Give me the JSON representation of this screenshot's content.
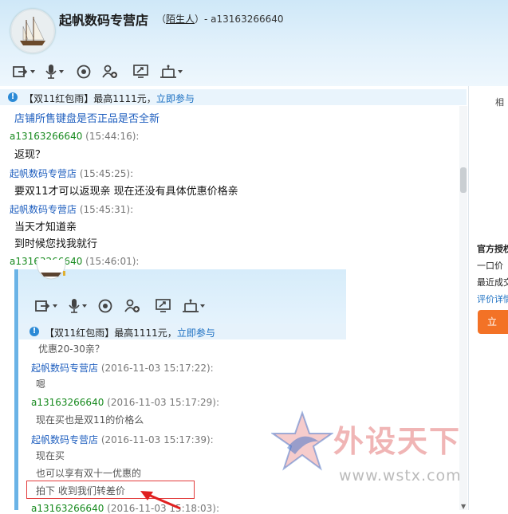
{
  "header": {
    "shop_name": "起帆数码专营店",
    "relation_prefix": "（",
    "relation": "陌生人",
    "relation_suffix": "）- a13163266640"
  },
  "toolbar": [
    "share-screen-icon",
    "microphone-icon",
    "camera-icon",
    "add-contact-icon",
    "screenshot-icon",
    "robot-icon"
  ],
  "notice": {
    "text": "【双11红包雨】最高1111元，",
    "link": "立即参与"
  },
  "messages": [
    {
      "text": "店铺所售键盘是否正品是否全新"
    },
    {
      "name": "a13163266640",
      "time": "(15:44:16):",
      "text": "返现？"
    },
    {
      "name": "起帆数码专营店",
      "time": "(15:45:25):",
      "text": "要双11才可以返现亲 现在还没有具体优惠价格亲"
    },
    {
      "name": "起帆数码专营店",
      "time": "(15:45:31):",
      "lines": [
        "当天才知道亲",
        "到时候您找我就行"
      ]
    },
    {
      "name": "a13163266640",
      "time": "(15:46:01):"
    }
  ],
  "embedded": {
    "notice_text": "【双11红包雨】最高1111元，",
    "notice_link": "立即参与",
    "messages": [
      {
        "text": "优惠20-30亲？"
      },
      {
        "name": "起帆数码专营店",
        "time": "(2016-11-03 15:17:22):",
        "text": "嗯"
      },
      {
        "name": "a13163266640",
        "time": "(2016-11-03 15:17:29):",
        "text": "现在买也是双11的价格么"
      },
      {
        "name": "起帆数码专营店",
        "time": "(2016-11-03 15:17:39):",
        "lines": [
          "现在买",
          "也可以享有双十一优惠的"
        ]
      },
      {
        "text": "拍下 收到我们转差价"
      },
      {
        "name": "a13163266640",
        "time": "(2016-11-03 15:18:03):"
      }
    ]
  },
  "right_panel": {
    "top_char": "相",
    "label1": "官方授权",
    "label2": "一口价",
    "label3": "最近成交",
    "link": "评价详情",
    "button": "立"
  },
  "watermark": {
    "cn": "外设天下",
    "url": "www.wstx.com"
  },
  "colors": {
    "shop_name_color": "#1f5fbf",
    "user_name_color": "#178a1e",
    "highlight": "#e23b3b",
    "accent_button": "#f37226"
  }
}
